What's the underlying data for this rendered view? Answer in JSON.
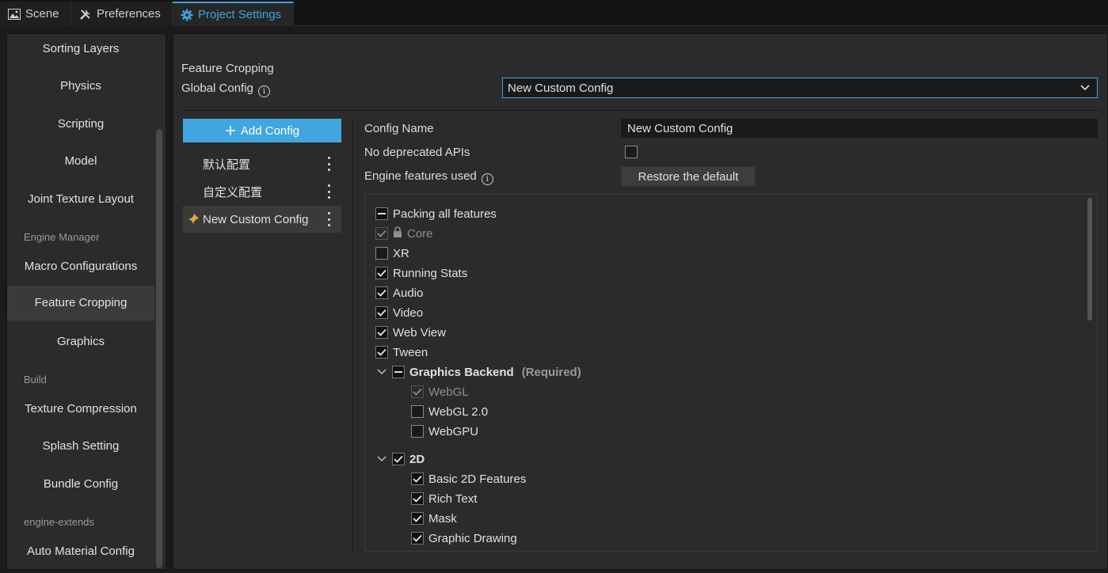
{
  "tabs": [
    {
      "label": "Scene",
      "icon": "image-icon"
    },
    {
      "label": "Preferences",
      "icon": "tools-icon"
    },
    {
      "label": "Project Settings",
      "icon": "gear-icon",
      "active": true
    }
  ],
  "sidebar": {
    "items": [
      {
        "label": "Sorting Layers"
      },
      {
        "label": "Physics"
      },
      {
        "label": "Scripting"
      },
      {
        "label": "Model"
      },
      {
        "label": "Joint Texture Layout"
      },
      {
        "group": "Engine Manager"
      },
      {
        "label": "Macro Configurations"
      },
      {
        "label": "Feature Cropping",
        "selected": true
      },
      {
        "label": "Graphics"
      },
      {
        "group": "Build"
      },
      {
        "label": "Texture Compression"
      },
      {
        "label": "Splash Setting"
      },
      {
        "label": "Bundle Config"
      },
      {
        "group": "engine-extends"
      },
      {
        "label": "Auto Material Config"
      }
    ]
  },
  "main": {
    "section_title": "Feature Cropping",
    "global_config_label": "Global Config",
    "global_config_value": "New Custom Config",
    "add_config_label": "Add Config",
    "configs": [
      {
        "label": "默认配置"
      },
      {
        "label": "自定义配置"
      },
      {
        "label": "New Custom Config",
        "selected": true
      }
    ],
    "config_name_label": "Config Name",
    "config_name_value": "New Custom Config",
    "no_deprecated_label": "No deprecated APIs",
    "no_deprecated_checked": false,
    "engine_features_label": "Engine features used",
    "restore_label": "Restore the default",
    "features": [
      {
        "label": "Packing all features",
        "state": "partial",
        "level": 0
      },
      {
        "label": "Core",
        "state": "checked-disabled",
        "level": 0,
        "locked": true
      },
      {
        "label": "XR",
        "state": "unchecked",
        "level": 0
      },
      {
        "label": "Running Stats",
        "state": "checked",
        "level": 0
      },
      {
        "label": "Audio",
        "state": "checked",
        "level": 0
      },
      {
        "label": "Video",
        "state": "checked",
        "level": 0
      },
      {
        "label": "Web View",
        "state": "checked",
        "level": 0
      },
      {
        "label": "Tween",
        "state": "checked",
        "level": 0
      },
      {
        "label": "Graphics Backend",
        "state": "partial",
        "level": 0,
        "group": true,
        "note": "(Required)"
      },
      {
        "label": "WebGL",
        "state": "checked-disabled",
        "level": 1
      },
      {
        "label": "WebGL 2.0",
        "state": "unchecked",
        "level": 1
      },
      {
        "label": "WebGPU",
        "state": "unchecked",
        "level": 1
      },
      {
        "label": "2D",
        "state": "checked",
        "level": 0,
        "group": true
      },
      {
        "label": "Basic 2D Features",
        "state": "checked",
        "level": 1
      },
      {
        "label": "Rich Text",
        "state": "checked",
        "level": 1
      },
      {
        "label": "Mask",
        "state": "checked",
        "level": 1
      },
      {
        "label": "Graphic Drawing",
        "state": "checked",
        "level": 1
      }
    ]
  }
}
